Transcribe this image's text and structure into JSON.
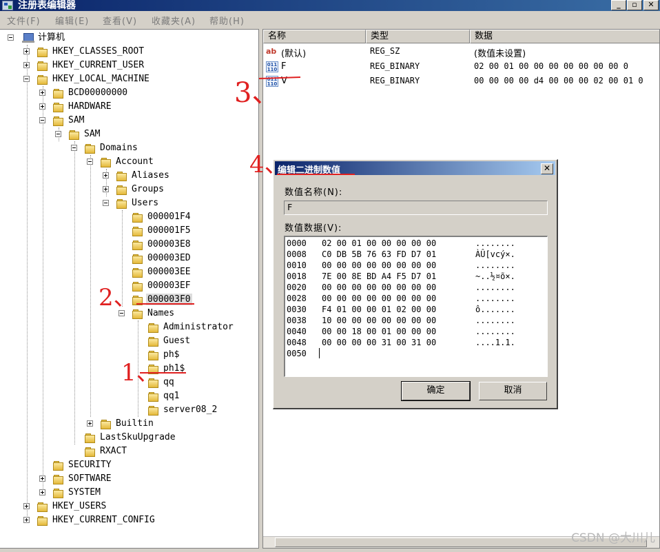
{
  "window": {
    "title": "注册表编辑器",
    "buttons": {
      "minimize": "_",
      "maximize": "▫",
      "close": "✕"
    }
  },
  "menu": [
    "文件(F)",
    "编辑(E)",
    "查看(V)",
    "收藏夹(A)",
    "帮助(H)"
  ],
  "tree": {
    "root": "计算机",
    "nodes": [
      {
        "label": "HKEY_CLASSES_ROOT",
        "toggle": "plus"
      },
      {
        "label": "HKEY_CURRENT_USER",
        "toggle": "plus"
      },
      {
        "label": "HKEY_LOCAL_MACHINE",
        "toggle": "minus"
      },
      {
        "label": "BCD00000000",
        "toggle": "plus"
      },
      {
        "label": "HARDWARE",
        "toggle": "plus"
      },
      {
        "label": "SAM",
        "toggle": "minus"
      },
      {
        "label": "SAM",
        "toggle": "minus"
      },
      {
        "label": "Domains",
        "toggle": "minus"
      },
      {
        "label": "Account",
        "toggle": "minus"
      },
      {
        "label": "Aliases",
        "toggle": "plus"
      },
      {
        "label": "Groups",
        "toggle": "plus"
      },
      {
        "label": "Users",
        "toggle": "minus"
      },
      {
        "label": "000001F4",
        "toggle": ""
      },
      {
        "label": "000001F5",
        "toggle": ""
      },
      {
        "label": "000003E8",
        "toggle": ""
      },
      {
        "label": "000003ED",
        "toggle": ""
      },
      {
        "label": "000003EE",
        "toggle": ""
      },
      {
        "label": "000003EF",
        "toggle": ""
      },
      {
        "label": "000003F0",
        "toggle": "",
        "selected": true
      },
      {
        "label": "Names",
        "toggle": "minus"
      },
      {
        "label": "Administrator",
        "toggle": ""
      },
      {
        "label": "Guest",
        "toggle": ""
      },
      {
        "label": "ph$",
        "toggle": ""
      },
      {
        "label": "ph1$",
        "toggle": ""
      },
      {
        "label": "qq",
        "toggle": ""
      },
      {
        "label": "qq1",
        "toggle": ""
      },
      {
        "label": "server08_2",
        "toggle": ""
      },
      {
        "label": "Builtin",
        "toggle": "plus"
      },
      {
        "label": "LastSkuUpgrade",
        "toggle": ""
      },
      {
        "label": "RXACT",
        "toggle": ""
      },
      {
        "label": "SECURITY",
        "toggle": ""
      },
      {
        "label": "SOFTWARE",
        "toggle": "plus"
      },
      {
        "label": "SYSTEM",
        "toggle": "plus"
      },
      {
        "label": "HKEY_USERS",
        "toggle": "plus"
      },
      {
        "label": "HKEY_CURRENT_CONFIG",
        "toggle": "plus"
      }
    ]
  },
  "list": {
    "columns": [
      "名称",
      "类型",
      "数据"
    ],
    "rows": [
      {
        "icon": "ab",
        "name": "(默认)",
        "type": "REG_SZ",
        "data": "(数值未设置)"
      },
      {
        "icon": "011 110",
        "name": "F",
        "type": "REG_BINARY",
        "data": "02 00 01 00 00 00 00 00 00 00 0"
      },
      {
        "icon": "011 110",
        "name": "V",
        "type": "REG_BINARY",
        "data": "00 00 00 00 d4 00 00 00 02 00 01 0"
      }
    ]
  },
  "dialog": {
    "title": "编辑二进制数值",
    "close": "✕",
    "name_label": "数值名称(N):",
    "name_value": "F",
    "data_label": "数值数据(V):",
    "hex_rows": [
      {
        "offset": "0000",
        "bytes": "02 00 01 00 00 00 00 00",
        "ascii": "........"
      },
      {
        "offset": "0008",
        "bytes": "C0 DB 5B 76 63 FD D7 01",
        "ascii": "ÀÛ[vcý×."
      },
      {
        "offset": "0010",
        "bytes": "00 00 00 00 00 00 00 00",
        "ascii": "........"
      },
      {
        "offset": "0018",
        "bytes": "7E 00 8E BD A4 F5 D7 01",
        "ascii": "~..½¤õ×."
      },
      {
        "offset": "0020",
        "bytes": "00 00 00 00 00 00 00 00",
        "ascii": "........"
      },
      {
        "offset": "0028",
        "bytes": "00 00 00 00 00 00 00 00",
        "ascii": "........"
      },
      {
        "offset": "0030",
        "bytes": "F4 01 00 00 01 02 00 00",
        "ascii": "ô......."
      },
      {
        "offset": "0038",
        "bytes": "10 00 00 00 00 00 00 00",
        "ascii": "........"
      },
      {
        "offset": "0040",
        "bytes": "00 00 18 00 01 00 00 00",
        "ascii": "........"
      },
      {
        "offset": "0048",
        "bytes": "00 00 00 00 31 00 31 00",
        "ascii": "....1.1."
      },
      {
        "offset": "0050",
        "bytes": "",
        "ascii": ""
      }
    ],
    "ok": "确定",
    "cancel": "取消"
  },
  "annotations": [
    "1、",
    "2、",
    "3、",
    "4、"
  ],
  "watermark": "CSDN @大川儿",
  "colors": {
    "titlebar": "#0a246a",
    "annotation": "#e02020",
    "selection": "#dcdcdc"
  }
}
